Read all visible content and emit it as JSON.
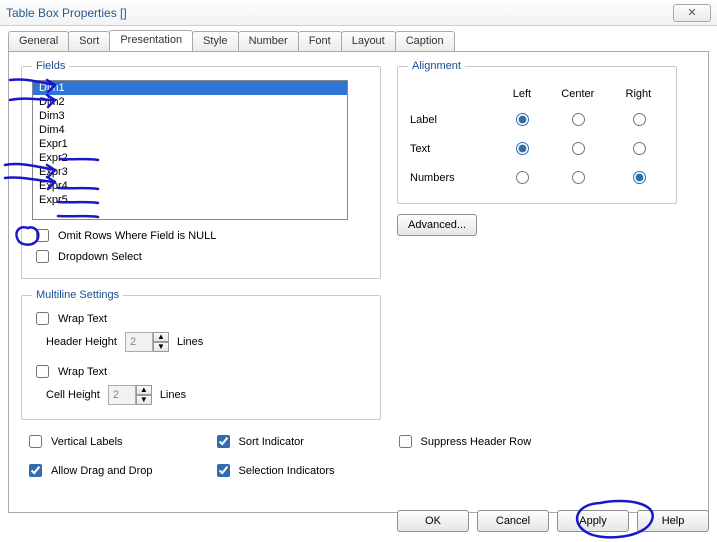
{
  "window": {
    "title": "Table Box Properties []"
  },
  "tabs": [
    "General",
    "Sort",
    "Presentation",
    "Style",
    "Number",
    "Font",
    "Layout",
    "Caption"
  ],
  "activeTab": 2,
  "fields": {
    "legend": "Fields",
    "items": [
      "Dim1",
      "Dim2",
      "Dim3",
      "Dim4",
      "Expr1",
      "Expr2",
      "Expr3",
      "Expr4",
      "Expr5"
    ],
    "selectedIndex": 0,
    "omitNullLabel": "Omit Rows Where Field is NULL",
    "omitNullChecked": false,
    "dropdownSelectLabel": "Dropdown Select",
    "dropdownSelectChecked": false
  },
  "alignment": {
    "legend": "Alignment",
    "cols": [
      "Left",
      "Center",
      "Right"
    ],
    "rows": [
      {
        "name": "Label",
        "selected": "Left"
      },
      {
        "name": "Text",
        "selected": "Left"
      },
      {
        "name": "Numbers",
        "selected": "Right"
      }
    ],
    "advancedLabel": "Advanced..."
  },
  "multiline": {
    "legend": "Multiline Settings",
    "wrapTextLabel": "Wrap Text",
    "headerHeightLabel": "Header Height",
    "headerHeightValue": "2",
    "cellHeightLabel": "Cell Height",
    "cellHeightValue": "2",
    "linesLabel": "Lines"
  },
  "options": {
    "verticalLabels": {
      "label": "Vertical Labels",
      "checked": false
    },
    "allowDragDrop": {
      "label": "Allow Drag and Drop",
      "checked": true
    },
    "sortIndicator": {
      "label": "Sort Indicator",
      "checked": true
    },
    "selectionIndicators": {
      "label": "Selection Indicators",
      "checked": true
    },
    "suppressHeaderRow": {
      "label": "Suppress Header Row",
      "checked": false
    }
  },
  "buttons": {
    "ok": "OK",
    "cancel": "Cancel",
    "apply": "Apply",
    "help": "Help"
  }
}
